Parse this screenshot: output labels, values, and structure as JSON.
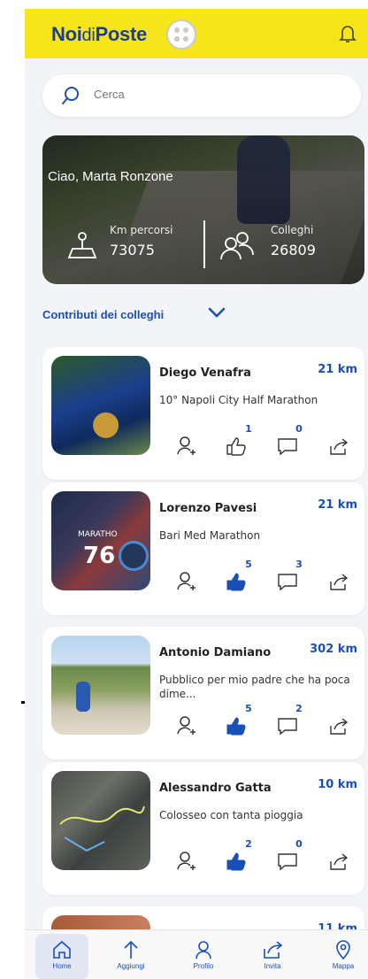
{
  "header": {
    "logo_main": "Noi",
    "logo_di": "di",
    "logo_end": "Poste"
  },
  "search": {
    "placeholder": "Cerca"
  },
  "hero": {
    "greeting": "Ciao, Marta Ronzone",
    "km_label": "Km percorsi",
    "km_value": "73075",
    "colleagues_label": "Colleghi",
    "colleagues_value": "26809"
  },
  "section": {
    "title": "Contributi dei colleghi"
  },
  "cards": [
    {
      "name": "Diego Venafra",
      "km": "21 km",
      "desc": "10° Napoli City Half Marathon",
      "likes": "1",
      "comments": "0",
      "liked": false
    },
    {
      "name": "Lorenzo Pavesi",
      "km": "21 km",
      "desc": "Bari Med Marathon",
      "likes": "5",
      "comments": "3",
      "liked": true,
      "photo_text": "MARATHO",
      "photo_num": "76"
    },
    {
      "name": "Antonio Damiano",
      "km": "302 km",
      "desc": "Pubblico per mio padre che ha poca dime...",
      "likes": "5",
      "comments": "2",
      "liked": true
    },
    {
      "name": "Alessandro Gatta",
      "km": "10 km",
      "desc": "Colosseo  con tanta pioggia",
      "likes": "2",
      "comments": "0",
      "liked": true
    }
  ],
  "partial_card": {
    "km": "11 km"
  },
  "nav": [
    {
      "label": "Home",
      "icon": "home-icon",
      "active": true
    },
    {
      "label": "Aggiungi",
      "icon": "arrow-up-icon"
    },
    {
      "label": "Profilo",
      "icon": "user-icon"
    },
    {
      "label": "Invita",
      "icon": "share-icon"
    },
    {
      "label": "Mappa",
      "icon": "map-pin-icon"
    }
  ],
  "colors": {
    "accent": "#1a4fb5",
    "header": "#f5e51a",
    "background": "#f3f4f7"
  }
}
